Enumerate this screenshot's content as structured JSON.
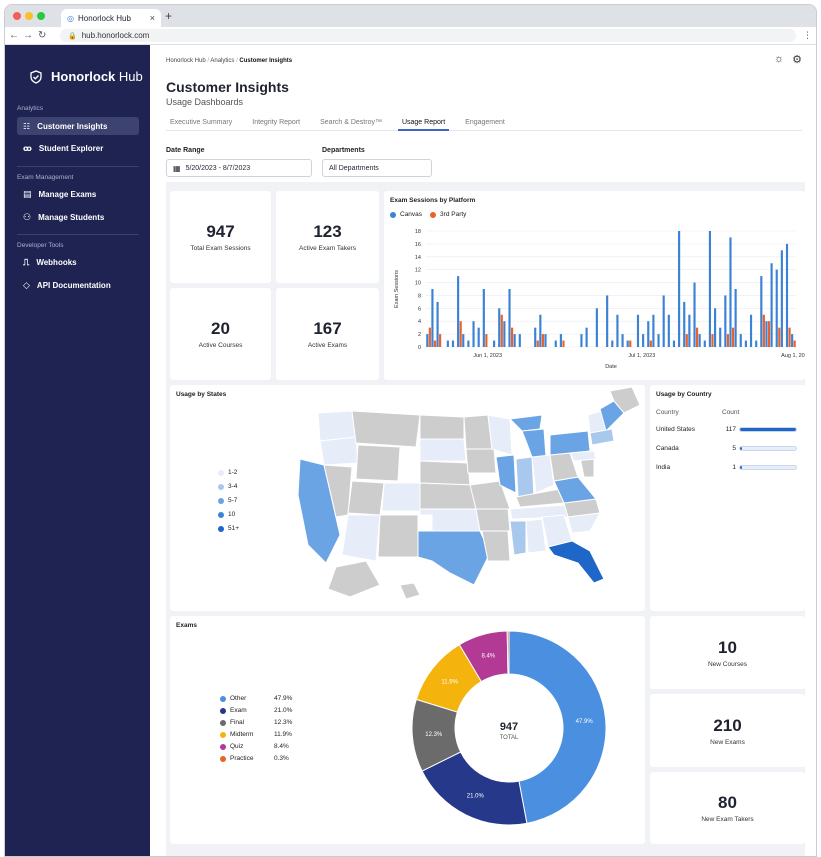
{
  "browser": {
    "tab_title": "Honorlock Hub",
    "url": "hub.honorlock.com"
  },
  "sidebar": {
    "logo_bold": "Honorlock",
    "logo_rest": "Hub",
    "sections": [
      {
        "title": "Analytics",
        "items": [
          {
            "label": "Customer Insights",
            "icon": "dashboard-icon",
            "active": true
          },
          {
            "label": "Student Explorer",
            "icon": "people-icon",
            "active": false
          }
        ]
      },
      {
        "title": "Exam Management",
        "items": [
          {
            "label": "Manage Exams",
            "icon": "document-icon"
          },
          {
            "label": "Manage Students",
            "icon": "person-gear-icon"
          }
        ]
      },
      {
        "title": "Developer Tools",
        "items": [
          {
            "label": "Webhooks",
            "icon": "webhook-icon"
          },
          {
            "label": "API Documentation",
            "icon": "code-icon"
          }
        ]
      }
    ]
  },
  "header": {
    "breadcrumb": [
      "Honorlock Hub",
      "Analytics",
      "Customer Insights"
    ],
    "title": "Customer Insights",
    "subtitle": "Usage Dashboards",
    "tabs": [
      "Executive Summary",
      "Integrity Report",
      "Search & Destroy™",
      "Usage Report",
      "Engagement"
    ],
    "active_tab": "Usage Report"
  },
  "filters": {
    "date_label": "Date Range",
    "date_value": "5/20/2023 - 8/7/2023",
    "dept_label": "Departments",
    "dept_value": "All Departments"
  },
  "stats": [
    {
      "value": "947",
      "caption": "Total Exam Sessions"
    },
    {
      "value": "123",
      "caption": "Active Exam Takers"
    },
    {
      "value": "20",
      "caption": "Active Courses"
    },
    {
      "value": "167",
      "caption": "Active Exams"
    }
  ],
  "colors": {
    "canvas": "#3b82d6",
    "third_party": "#e8622a",
    "sidebar": "#1e2352",
    "accent": "#3f63c9"
  },
  "chart_data": [
    {
      "type": "bar",
      "title": "Exam Sessions by Platform",
      "xlabel": "Date",
      "ylabel": "Exam Sessions",
      "ylim": [
        0,
        18
      ],
      "yticks": [
        0,
        2,
        4,
        6,
        8,
        10,
        12,
        14,
        16,
        18
      ],
      "xticks": [
        "Jun 1, 2023",
        "Jul 1, 2023",
        "Aug 1, 2023"
      ],
      "legend_position": "top-left",
      "series": [
        {
          "name": "Canvas",
          "values": [
            2,
            9,
            7,
            0,
            1,
            1,
            11,
            2,
            1,
            4,
            3,
            9,
            0,
            1,
            6,
            4,
            9,
            2,
            2,
            0,
            0,
            3,
            5,
            2,
            0,
            1,
            2,
            0,
            0,
            0,
            2,
            3,
            0,
            6,
            0,
            8,
            1,
            5,
            2,
            1,
            0,
            5,
            2,
            4,
            5,
            2,
            8,
            5,
            1,
            18,
            7,
            5,
            10,
            2,
            1,
            18,
            6,
            3,
            8,
            17,
            9,
            2,
            1,
            5,
            1,
            11,
            4,
            13,
            12,
            15,
            16,
            2
          ]
        },
        {
          "name": "3rd Party",
          "values": [
            3,
            1,
            2,
            0,
            0,
            0,
            4,
            0,
            0,
            0,
            0,
            2,
            0,
            0,
            5,
            0,
            3,
            0,
            0,
            0,
            0,
            1,
            2,
            0,
            0,
            0,
            1,
            0,
            0,
            0,
            0,
            0,
            0,
            0,
            0,
            0,
            0,
            0,
            0,
            1,
            0,
            0,
            0,
            1,
            0,
            0,
            0,
            0,
            0,
            0,
            2,
            0,
            3,
            0,
            0,
            2,
            0,
            0,
            2,
            3,
            0,
            0,
            0,
            0,
            0,
            5,
            4,
            0,
            3,
            0,
            3,
            1
          ]
        }
      ]
    },
    {
      "type": "pie",
      "title": "Exams",
      "center_value": "947",
      "center_label": "TOTAL",
      "slices": [
        {
          "name": "Other",
          "value": 47.9,
          "label": "47.9%",
          "color": "#4a8fe0"
        },
        {
          "name": "Exam",
          "value": 21.0,
          "label": "21.0%",
          "color": "#25388a"
        },
        {
          "name": "Final",
          "value": 12.3,
          "label": "12.3%",
          "color": "#6b6b6b"
        },
        {
          "name": "Midterm",
          "value": 11.9,
          "label": "11.9%",
          "color": "#f5b40d"
        },
        {
          "name": "Quiz",
          "value": 8.4,
          "label": "8.4%",
          "color": "#b23a94"
        },
        {
          "name": "Practice",
          "value": 0.3,
          "label": "0.3%",
          "color": "#e8622a"
        }
      ]
    }
  ],
  "states_map": {
    "title": "Usage by States",
    "legend": [
      {
        "label": "1-2",
        "color": "#e6edf8"
      },
      {
        "label": "3-4",
        "color": "#a8c8ee"
      },
      {
        "label": "5-7",
        "color": "#6aa4e4"
      },
      {
        "label": "10",
        "color": "#3a84d6"
      },
      {
        "label": "51+",
        "color": "#1e66c8"
      }
    ]
  },
  "country": {
    "title": "Usage by Country",
    "col_country": "Country",
    "col_count": "Count",
    "rows": [
      {
        "name": "United States",
        "count": "117",
        "fraction": 1.0
      },
      {
        "name": "Canada",
        "count": "5",
        "fraction": 0.04
      },
      {
        "name": "India",
        "count": "1",
        "fraction": 0.01
      }
    ]
  },
  "side_stats": [
    {
      "value": "10",
      "caption": "New Courses"
    },
    {
      "value": "210",
      "caption": "New Exams"
    },
    {
      "value": "80",
      "caption": "New Exam Takers"
    }
  ]
}
